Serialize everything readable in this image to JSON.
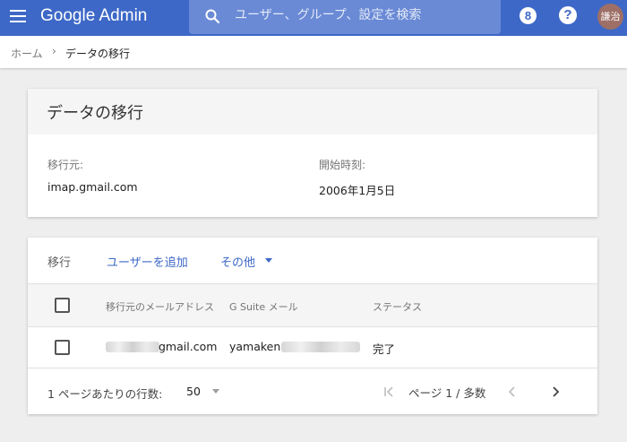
{
  "header": {
    "app_title": "Google Admin",
    "search_placeholder": "ユーザー、グループ、設定を検索",
    "apps_glyph": "8",
    "help_glyph": "?",
    "avatar_text": "謙治"
  },
  "breadcrumb": {
    "home": "ホーム",
    "separator": "›",
    "current": "データの移行"
  },
  "migration_card": {
    "title": "データの移行",
    "source_label": "移行元:",
    "source_value": "imap.gmail.com",
    "start_label": "開始時刻:",
    "start_value": "2006年1月5日"
  },
  "list_card": {
    "toolbar": {
      "title": "移行",
      "add_user": "ユーザーを追加",
      "more": "その他"
    },
    "columns": [
      "移行元のメールアドレス",
      "G Suite メール",
      "ステータス"
    ],
    "rows": [
      {
        "source_email": "gmail.com",
        "gsuite_email": "yamaken@",
        "status": "完了",
        "checked": false
      }
    ],
    "footer": {
      "rows_per_page_label": "1 ページあたりの行数:",
      "rows_per_page_value": "50",
      "page_info": "ページ 1 / 多数"
    }
  },
  "colors": {
    "brand_blue": "#3d68c7",
    "search_bg": "#6a8ad6",
    "page_bg": "#eeeeee",
    "avatar_bg": "#9d6f66"
  },
  "icons": [
    "menu-icon",
    "search-icon",
    "apps-icon",
    "help-icon",
    "chevron-right-icon",
    "caret-down-icon",
    "first-page-icon",
    "prev-page-icon",
    "next-page-icon"
  ]
}
